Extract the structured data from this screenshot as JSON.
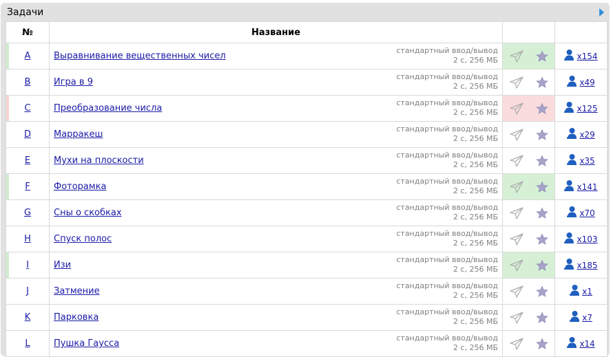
{
  "panel": {
    "title": "Задачи"
  },
  "table": {
    "header_num": "№",
    "header_name": "Название"
  },
  "problems": [
    {
      "code": "A",
      "name": "Выравнивание вещественных чисел",
      "io": "стандартный ввод/вывод",
      "limits": "2 с, 256 МБ",
      "solved": "x154",
      "status": "accepted"
    },
    {
      "code": "B",
      "name": "Игра в 9",
      "io": "стандартный ввод/вывод",
      "limits": "2 с, 256 МБ",
      "solved": "x49",
      "status": "none"
    },
    {
      "code": "C",
      "name": "Преобразование числа",
      "io": "стандартный ввод/вывод",
      "limits": "2 с, 256 МБ",
      "solved": "x125",
      "status": "rejected"
    },
    {
      "code": "D",
      "name": "Марракеш",
      "io": "стандартный ввод/вывод",
      "limits": "2 с, 256 МБ",
      "solved": "x29",
      "status": "none"
    },
    {
      "code": "E",
      "name": "Мухи на плоскости",
      "io": "стандартный ввод/вывод",
      "limits": "2 с, 256 МБ",
      "solved": "x35",
      "status": "none"
    },
    {
      "code": "F",
      "name": "Фоторамка",
      "io": "стандартный ввод/вывод",
      "limits": "2 с, 256 МБ",
      "solved": "x141",
      "status": "accepted"
    },
    {
      "code": "G",
      "name": "Сны о скобках",
      "io": "стандартный ввод/вывод",
      "limits": "2 с, 256 МБ",
      "solved": "x70",
      "status": "none"
    },
    {
      "code": "H",
      "name": "Спуск полос",
      "io": "стандартный ввод/вывод",
      "limits": "2 с, 256 МБ",
      "solved": "x103",
      "status": "none"
    },
    {
      "code": "I",
      "name": "Изи",
      "io": "стандартный ввод/вывод",
      "limits": "2 с, 256 МБ",
      "solved": "x185",
      "status": "accepted"
    },
    {
      "code": "J",
      "name": "Затмение",
      "io": "стандартный ввод/вывод",
      "limits": "2 с, 256 МБ",
      "solved": "x1",
      "status": "none"
    },
    {
      "code": "K",
      "name": "Парковка",
      "io": "стандартный ввод/вывод",
      "limits": "2 с, 256 МБ",
      "solved": "x7",
      "status": "none"
    },
    {
      "code": "L",
      "name": "Пушка Гаусса",
      "io": "стандартный ввод/вывод",
      "limits": "2 с, 256 МБ",
      "solved": "x14",
      "status": "none"
    }
  ],
  "icons": {
    "submit": "send-icon",
    "favorite": "star-icon",
    "solvers": "user-icon",
    "expand": "triangle-right-icon"
  },
  "colors": {
    "accepted_bg": "#d6f0d6",
    "rejected_bg": "#fbdcdc",
    "link": "#1a1aa8",
    "star": "#a6a3c9",
    "user_icon": "#1f5fbf"
  }
}
